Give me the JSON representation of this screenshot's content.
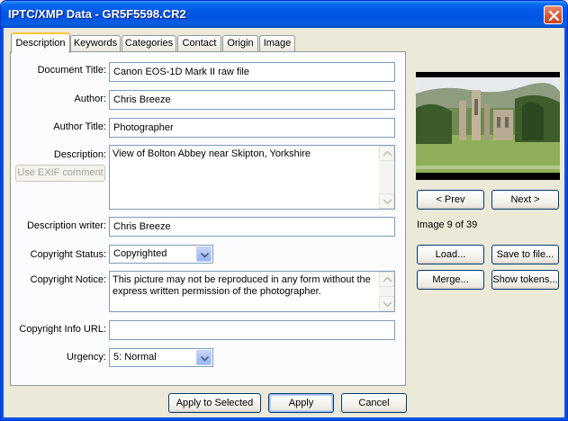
{
  "window": {
    "title": "IPTC/XMP Data - GR5F5598.CR2"
  },
  "tabs": [
    {
      "label": "Description",
      "active": true
    },
    {
      "label": "Keywords",
      "active": false
    },
    {
      "label": "Categories",
      "active": false
    },
    {
      "label": "Contact",
      "active": false
    },
    {
      "label": "Origin",
      "active": false
    },
    {
      "label": "Image",
      "active": false
    }
  ],
  "form": {
    "document_title": {
      "label": "Document Title:",
      "value": "Canon EOS-1D Mark II raw file"
    },
    "author": {
      "label": "Author:",
      "value": "Chris Breeze"
    },
    "author_title": {
      "label": "Author Title:",
      "value": "Photographer"
    },
    "description": {
      "label": "Description:",
      "value": "View of Bolton Abbey near Skipton, Yorkshire",
      "exif_button": "Use EXIF comment"
    },
    "description_writer": {
      "label": "Description writer:",
      "value": "Chris Breeze"
    },
    "copyright_status": {
      "label": "Copyright Status:",
      "value": "Copyrighted"
    },
    "copyright_notice": {
      "label": "Copyright Notice:",
      "value": "This picture may not be reproduced in any form without the express written permission of the photographer."
    },
    "copyright_url": {
      "label": "Copyright Info URL:",
      "value": ""
    },
    "urgency": {
      "label": "Urgency:",
      "value": "5: Normal"
    }
  },
  "preview": {
    "prev_label": "< Prev",
    "next_label": "Next >",
    "counter": "Image 9 of 39"
  },
  "side_buttons": {
    "load": "Load...",
    "save": "Save to file...",
    "merge": "Merge...",
    "show_tokens": "Show tokens..."
  },
  "footer": {
    "apply_selected": "Apply to Selected",
    "apply": "Apply",
    "cancel": "Cancel"
  },
  "colors": {
    "titlebar": "#0054e3",
    "face": "#ece9d8",
    "active_tab_highlight": "#ffc73c",
    "input_border": "#7f9db9"
  }
}
